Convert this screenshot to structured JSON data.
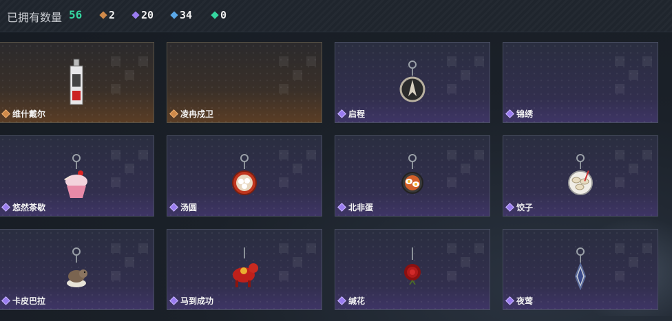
{
  "header": {
    "owned_label": "已拥有数量",
    "owned_count": "56",
    "stats": [
      {
        "icon": "orange-rarity-icon",
        "color": "#d08a4a",
        "value": "2"
      },
      {
        "icon": "purple-rarity-icon",
        "color": "#9a7cf0",
        "value": "20"
      },
      {
        "icon": "blue-rarity-icon",
        "color": "#5aa8e8",
        "value": "34"
      },
      {
        "icon": "green-rarity-icon",
        "color": "#35d6a0",
        "value": "0"
      }
    ]
  },
  "items": [
    {
      "name": "维什戴尔",
      "rarity": "orange",
      "icon": "lighter-charm-icon"
    },
    {
      "name": "凌冉戍卫",
      "rarity": "orange",
      "icon": "empty-slot"
    },
    {
      "name": "启程",
      "rarity": "purple",
      "icon": "compass-charm-icon"
    },
    {
      "name": "锦绣",
      "rarity": "purple",
      "icon": "empty-slot"
    },
    {
      "name": "悠然茶歇",
      "rarity": "purple",
      "icon": "cupcake-charm-icon"
    },
    {
      "name": "汤圆",
      "rarity": "purple",
      "icon": "tangyuan-charm-icon"
    },
    {
      "name": "北非蛋",
      "rarity": "purple",
      "icon": "shakshuka-charm-icon"
    },
    {
      "name": "饺子",
      "rarity": "purple",
      "icon": "dumpling-charm-icon"
    },
    {
      "name": "卡皮巴拉",
      "rarity": "purple",
      "icon": "capybara-charm-icon"
    },
    {
      "name": "马到成功",
      "rarity": "purple",
      "icon": "horse-charm-icon"
    },
    {
      "name": "缄花",
      "rarity": "purple",
      "icon": "rose-charm-icon"
    },
    {
      "name": "夜莺",
      "rarity": "purple",
      "icon": "nightingale-charm-icon"
    }
  ]
}
